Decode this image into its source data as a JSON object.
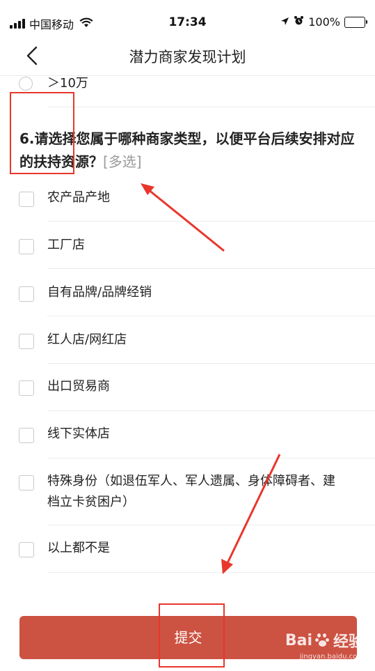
{
  "status_bar": {
    "carrier": "中国移动",
    "time": "17:34",
    "battery": "100%"
  },
  "nav": {
    "title": "潜力商家发现计划"
  },
  "prev_question": {
    "last_option": "＞10万"
  },
  "question": {
    "text": "6.请选择您属于哪种商家类型，以便平台后续安排对应的扶持资源？",
    "tag": "[多选]"
  },
  "options": [
    "农产品产地",
    "工厂店",
    "自有品牌/品牌经销",
    "红人店/网红店",
    "出口贸易商",
    "线下实体店",
    "特殊身份（如退伍军人、军人遗属、身体障碍者、建档立卡贫困户）",
    "以上都不是"
  ],
  "submit": {
    "label": "提交"
  },
  "watermark": {
    "brand": "Bai",
    "brand_suffix": "经验",
    "url": "jingyan.baidu.com"
  },
  "colors": {
    "submit_bg": "#cc5242",
    "annotation": "#e8362c"
  }
}
